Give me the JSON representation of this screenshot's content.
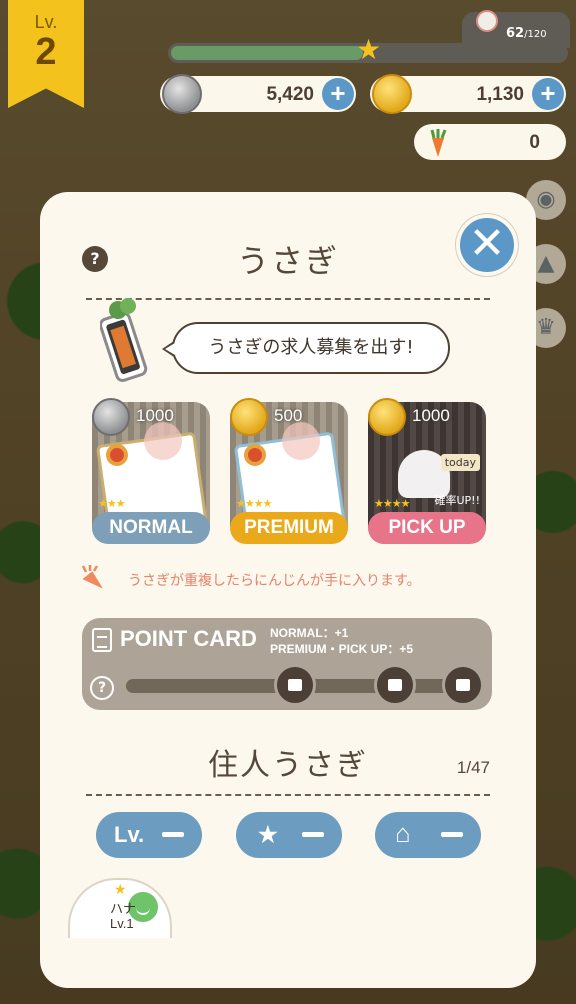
{
  "hud": {
    "level_label": "Lv.",
    "level": "2",
    "xp_current": "62",
    "xp_max": "/120",
    "xp_progress": 0.52,
    "silver_coins": "5,420",
    "gold_coins": "1,130",
    "carrots": "0"
  },
  "modal": {
    "title": "うさぎ",
    "help": "?",
    "close": "✕",
    "speech": "うさぎの求人募集を出す!",
    "cards": [
      {
        "cost": "1000",
        "currency": "silver",
        "label": "NORMAL",
        "label_color": "#7d9fb8",
        "stars": "★★★"
      },
      {
        "cost": "500",
        "currency": "gold",
        "label": "PREMIUM",
        "label_color": "#e9a91a",
        "stars": "★★★★"
      },
      {
        "cost": "1000",
        "currency": "gold",
        "label": "PICK UP",
        "label_color": "#e8748a",
        "stars": "★★★★",
        "badge": "today",
        "up_text": "確率UP!!"
      }
    ],
    "carrot_note": "うさぎが重複したらにんじんが手に入ります。",
    "point_card": {
      "title": "POINT CARD",
      "note_line1": "NORMAL：+1",
      "note_line2": "PREMIUM・PICK UP：+5",
      "help": "?"
    },
    "residents_title": "住人うさぎ",
    "residents_count": "1/47",
    "sort_buttons": [
      {
        "label": "Lv.",
        "icon": "level-text"
      },
      {
        "label": "★",
        "icon": "star-icon"
      },
      {
        "label": "⌂",
        "icon": "house-icon"
      }
    ],
    "bunny": {
      "name": "ハナ",
      "level": "Lv.1",
      "rarity": "★"
    }
  },
  "colors": {
    "accent_blue": "#5b97c7",
    "gold": "#f4c21c",
    "panel": "#fcf8ee",
    "text_dark": "#55483a"
  }
}
